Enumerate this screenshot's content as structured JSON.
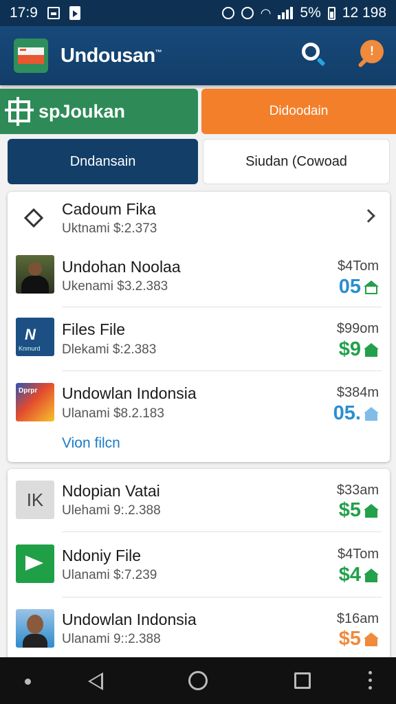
{
  "status_bar": {
    "time": "17:9",
    "battery": "5%",
    "clock_right": "12 198"
  },
  "app_bar": {
    "title": "Undousan",
    "title_mark": "™"
  },
  "buttons": {
    "green": "spJoukan",
    "orange": "Didoodain",
    "navy": "Dndansain",
    "white": "Siudan (Cowoad"
  },
  "card1": {
    "header": {
      "title": "Cadoum Fika",
      "sub": "Uktnami $:2.373"
    },
    "items": [
      {
        "title": "Undohan Noolaa",
        "sub": "Ukenami $3.2.383",
        "price": "$4Tom",
        "value": "05",
        "color": "#2a8fd0",
        "icon": "house-outline-icon"
      },
      {
        "title": "Files File",
        "sub": "Dlekami $:2.383",
        "price": "$99om",
        "value": "$9",
        "color": "#22a04b",
        "icon": "house-icon",
        "thumb_label": "Knmurd"
      },
      {
        "title": "Undowlan Indonsia",
        "sub": "Ulanami $8.2.183",
        "price": "$384m",
        "value": "05.",
        "color": "#2a8fd0",
        "icon": "house-icon",
        "thumb_label": "Dprpr"
      }
    ],
    "link": "Vion filcn"
  },
  "card2": {
    "items": [
      {
        "title": "Ndopian Vatai",
        "sub": "Ulehami 9:.2.388",
        "price": "$33am",
        "value": "$5",
        "color": "#22a04b",
        "icon": "house-icon",
        "thumb_label": "IK"
      },
      {
        "title": "Ndoniy File",
        "sub": "Ulanami $:7.239",
        "price": "$4Tom",
        "value": "$4",
        "color": "#22a04b",
        "icon": "house-icon"
      },
      {
        "title": "Undowlan Indonsia",
        "sub": "Ulanami 9::2.388",
        "price": "$16am",
        "value": "$5",
        "color": "#f08a3c",
        "icon": "house-icon"
      }
    ]
  }
}
